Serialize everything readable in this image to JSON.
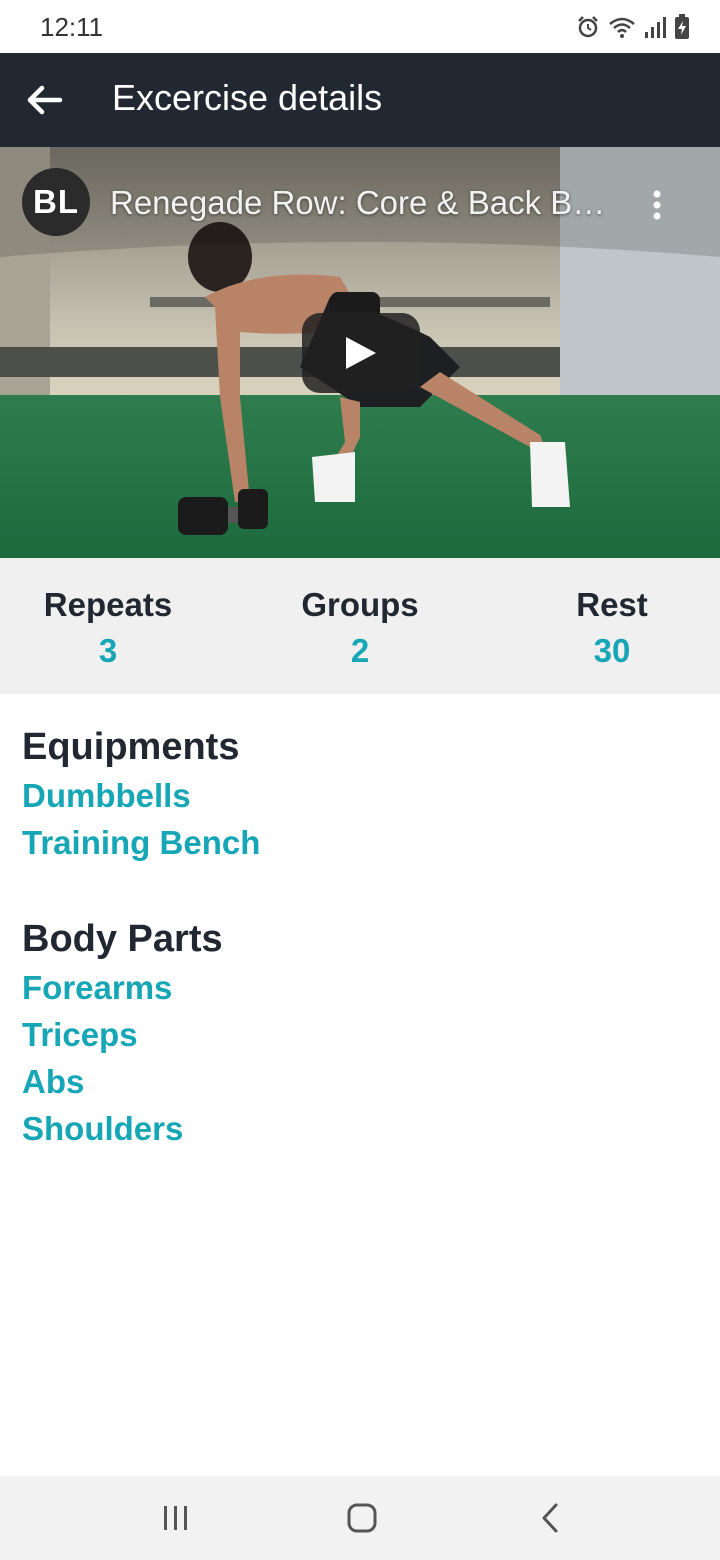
{
  "status_bar": {
    "time": "12:11",
    "icons": [
      "alarm-icon",
      "wifi-icon",
      "signal-icon",
      "battery-charging-icon"
    ]
  },
  "app_bar": {
    "back_icon": "arrow-left-icon",
    "title": "Excercise details"
  },
  "video": {
    "channel_initials": "BL",
    "title": "Renegade Row: Core & Back Bu…",
    "more_icon": "more-vertical-icon",
    "play_icon": "play-icon"
  },
  "stats": [
    {
      "label": "Repeats",
      "value": "3"
    },
    {
      "label": "Groups",
      "value": "2"
    },
    {
      "label": "Rest",
      "value": "30"
    }
  ],
  "equipments": {
    "title": "Equipments",
    "items": [
      "Dumbbells",
      "Training Bench"
    ]
  },
  "body_parts": {
    "title": "Body Parts",
    "items": [
      "Forearms",
      "Triceps",
      "Abs",
      "Shoulders"
    ]
  },
  "nav_bar": {
    "icons": [
      "recent-apps-icon",
      "home-icon",
      "back-nav-icon"
    ]
  },
  "colors": {
    "app_bar": "#222831",
    "accent": "#16a6b6",
    "stats_background": "#f0f0f0",
    "nav_background": "#f2f2f2"
  }
}
